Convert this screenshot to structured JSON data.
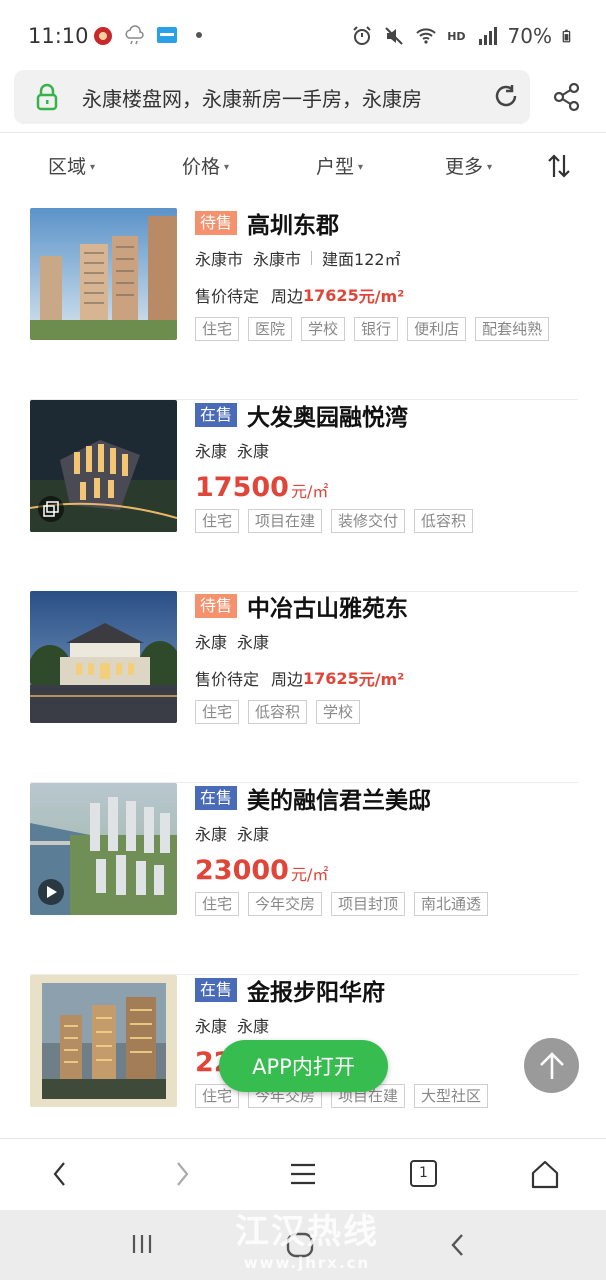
{
  "status_bar": {
    "time": "11:10",
    "battery": "70%",
    "network_label": "HD",
    "icons": [
      "app-badge-icon",
      "weather-icon",
      "news-app-icon",
      "dot-icon",
      "alarm-icon",
      "mute-icon",
      "wifi-icon",
      "signal-icon",
      "battery-icon"
    ]
  },
  "browser": {
    "url_text": "永康楼盘网，永康新房一手房，永康房",
    "tab_count": "1"
  },
  "filters": [
    "区域",
    "价格",
    "户型",
    "更多"
  ],
  "listings": [
    {
      "status": "待售",
      "status_type": "pending",
      "title": "高圳东郡",
      "loc1": "永康市",
      "loc2": "永康市",
      "area": "建面122㎡",
      "price_mode": "pending",
      "price_label": "售价待定",
      "price_prefix": "周边",
      "price_value": "17625",
      "price_unit": "元/m²",
      "tags": [
        "住宅",
        "医院",
        "学校",
        "银行",
        "便利店",
        "配套纯熟"
      ]
    },
    {
      "status": "在售",
      "status_type": "onsale",
      "title": "大发奥园融悦湾",
      "loc1": "永康",
      "loc2": "永康",
      "area": "",
      "price_mode": "big",
      "price_value": "17500",
      "price_unit": "元/㎡",
      "thumb_badge": "gallery-icon",
      "tags": [
        "住宅",
        "项目在建",
        "装修交付",
        "低容积"
      ]
    },
    {
      "status": "待售",
      "status_type": "pending",
      "title": "中冶古山雅苑东",
      "loc1": "永康",
      "loc2": "永康",
      "area": "",
      "price_mode": "pending",
      "price_label": "售价待定",
      "price_prefix": "周边",
      "price_value": "17625",
      "price_unit": "元/m²",
      "tags": [
        "住宅",
        "低容积",
        "学校"
      ]
    },
    {
      "status": "在售",
      "status_type": "onsale",
      "title": "美的融信君兰美邸",
      "loc1": "永康",
      "loc2": "永康",
      "area": "",
      "price_mode": "big",
      "price_value": "23000",
      "price_unit": "元/㎡",
      "thumb_badge": "play-icon",
      "tags": [
        "住宅",
        "今年交房",
        "项目封顶",
        "南北通透"
      ]
    },
    {
      "status": "在售",
      "status_type": "onsale",
      "title": "金报步阳华府",
      "loc1": "永康",
      "loc2": "永康",
      "area": "",
      "price_mode": "big",
      "price_value": "22",
      "price_unit": "",
      "tags": [
        "住宅",
        "今年交房",
        "项目在建",
        "大型社区"
      ]
    }
  ],
  "floating": {
    "app_open": "APP内打开"
  },
  "watermark": {
    "line1": "江汉热线",
    "line2": "www.jhrx.cn"
  }
}
